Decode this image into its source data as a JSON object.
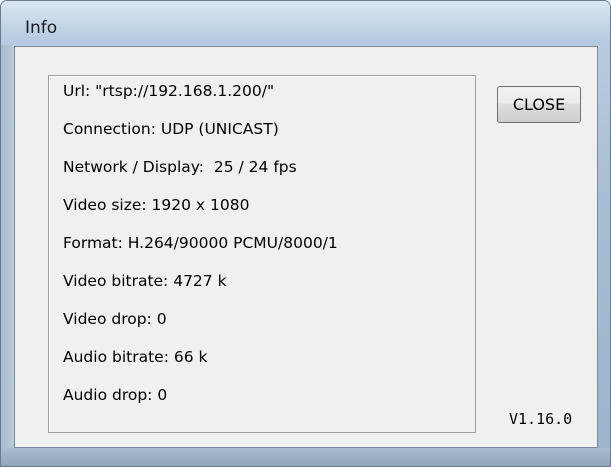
{
  "window": {
    "title": "Info"
  },
  "info": {
    "lines": [
      "Url: \"rtsp://192.168.1.200/\"",
      "Connection: UDP (UNICAST)",
      "Network / Display:  25 / 24 fps",
      "Video size: 1920 x 1080",
      "Format: H.264/90000 PCMU/8000/1",
      "Video bitrate: 4727 k",
      "Video drop: 0",
      "Audio bitrate: 66 k",
      "Audio drop: 0"
    ]
  },
  "buttons": {
    "close_label": "CLOSE"
  },
  "version": "V1.16.0"
}
